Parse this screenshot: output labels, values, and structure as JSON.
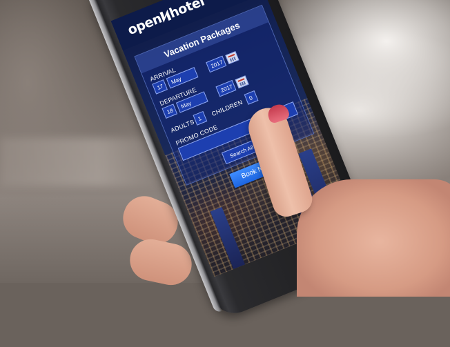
{
  "app": {
    "logo_text_left": "open",
    "logo_text_right": "hotel"
  },
  "nav": {
    "menu_icon": "hamburger-menu-icon"
  },
  "form": {
    "title": "Vacation Packages",
    "arrival": {
      "label": "ARRIVAL",
      "day": "17",
      "month": "May",
      "year": "2017"
    },
    "departure": {
      "label": "DEPARTURE",
      "day": "18",
      "month": "May",
      "year": "2017"
    },
    "adults": {
      "label": "ADULTS",
      "value": "1"
    },
    "children": {
      "label": "CHILDREN",
      "value": "0"
    },
    "promo": {
      "label": "PROMO CODE",
      "value": ""
    },
    "search_button": "Search All Hotels",
    "book_button": "Book Now"
  },
  "colors": {
    "nav_bg": "#0d1b4a",
    "field_bg": "#1d3fb0",
    "book_button": "#2a78f0",
    "nail_polish": "#d04a5c"
  }
}
